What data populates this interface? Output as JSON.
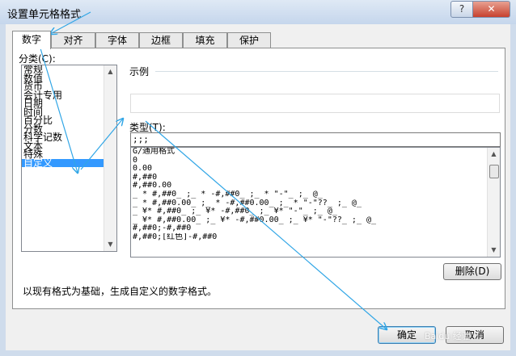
{
  "dialog": {
    "title": "设置单元格格式",
    "help_label": "?",
    "close_label": "✕"
  },
  "tabs": [
    {
      "label": "数字"
    },
    {
      "label": "对齐"
    },
    {
      "label": "字体"
    },
    {
      "label": "边框"
    },
    {
      "label": "填充"
    },
    {
      "label": "保护"
    }
  ],
  "category": {
    "label": "分类(C):",
    "items": [
      {
        "label": "常规"
      },
      {
        "label": "数值"
      },
      {
        "label": "货币"
      },
      {
        "label": "会计专用"
      },
      {
        "label": "日期"
      },
      {
        "label": "时间"
      },
      {
        "label": "百分比"
      },
      {
        "label": "分数"
      },
      {
        "label": "科学记数"
      },
      {
        "label": "文本"
      },
      {
        "label": "特殊"
      },
      {
        "label": "自定义"
      }
    ],
    "selected": "自定义"
  },
  "sample": {
    "label": "示例"
  },
  "type": {
    "label": "类型(T):",
    "value": ";;;",
    "formats": [
      "G/通用格式",
      "0",
      "0.00",
      "#,##0",
      "#,##0.00",
      "_ * #,##0_ ;_ * -#,##0_ ;_ * \"-\"_ ;_ @_",
      "_ * #,##0.00_ ;_ * -#,##0.00_ ;_ * \"-\"??_ ;_ @_",
      "_ ¥* #,##0_ ;_ ¥* -#,##0_ ;_ ¥* \"-\"_ ;_ @_",
      "_ ¥* #,##0.00_ ;_ ¥* -#,##0.00_ ;_ ¥* \"-\"??_ ;_ @_",
      "#,##0;-#,##0",
      "#,##0;[红色]-#,##0"
    ]
  },
  "delete_label": "删除(D)",
  "description": "以现有格式为基础，生成自定义的数字格式。",
  "ok_label": "确定",
  "cancel_label": "取消",
  "watermark": "Baidu 经验",
  "colors": {
    "annotation": "#31a6e6",
    "selection": "#3399ff"
  }
}
